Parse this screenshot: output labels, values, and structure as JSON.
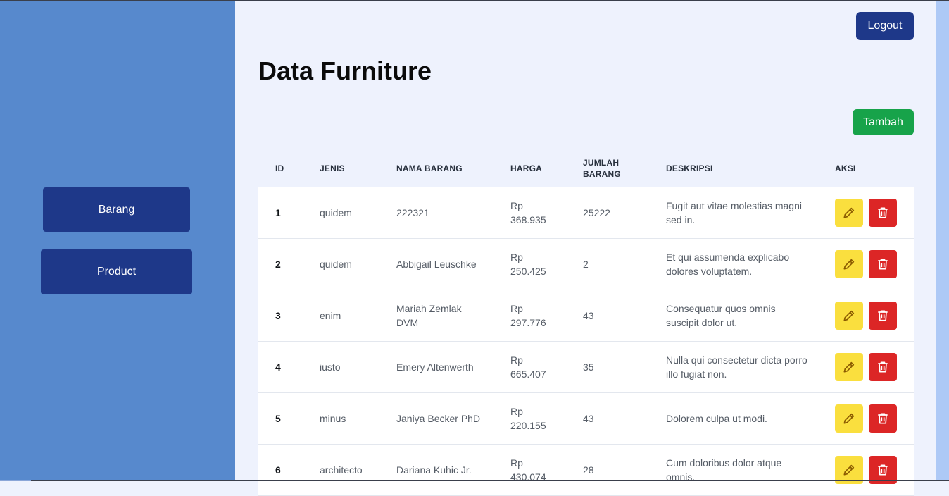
{
  "sidebar": {
    "items": [
      {
        "label": "Barang"
      },
      {
        "label": "Product"
      }
    ]
  },
  "header": {
    "logout_label": "Logout"
  },
  "main": {
    "title": "Data Furniture",
    "add_label": "Tambah",
    "table": {
      "columns": [
        "ID",
        "JENIS",
        "NAMA BARANG",
        "HARGA",
        "JUMLAH BARANG",
        "DESKRIPSI",
        "AKSI"
      ],
      "rows": [
        {
          "id": "1",
          "jenis": "quidem",
          "nama": "222321",
          "harga": "Rp 368.935",
          "jumlah": "25222",
          "deskripsi": "Fugit aut vitae molestias magni sed in."
        },
        {
          "id": "2",
          "jenis": "quidem",
          "nama": "Abbigail Leuschke",
          "harga": "Rp 250.425",
          "jumlah": "2",
          "deskripsi": "Et qui assumenda explicabo dolores voluptatem."
        },
        {
          "id": "3",
          "jenis": "enim",
          "nama": "Mariah Zemlak DVM",
          "harga": "Rp 297.776",
          "jumlah": "43",
          "deskripsi": "Consequatur quos omnis suscipit dolor ut."
        },
        {
          "id": "4",
          "jenis": "iusto",
          "nama": "Emery Altenwerth",
          "harga": "Rp 665.407",
          "jumlah": "35",
          "deskripsi": "Nulla qui consectetur dicta porro illo fugiat non."
        },
        {
          "id": "5",
          "jenis": "minus",
          "nama": "Janiya Becker PhD",
          "harga": "Rp 220.155",
          "jumlah": "43",
          "deskripsi": "Dolorem culpa ut modi."
        },
        {
          "id": "6",
          "jenis": "architecto",
          "nama": "Dariana Kuhic Jr.",
          "harga": "Rp 430.074",
          "jumlah": "28",
          "deskripsi": "Cum doloribus dolor atque omnis."
        }
      ]
    }
  },
  "icons": {
    "edit": "pencil-icon",
    "delete": "trash-icon"
  },
  "colors": {
    "sidebar": "#5789cd",
    "primary_button": "#1e3889",
    "add_button": "#17a34a",
    "edit_button": "#fadf3e",
    "delete_button": "#dc2626",
    "page_background": "#eef2fd"
  }
}
